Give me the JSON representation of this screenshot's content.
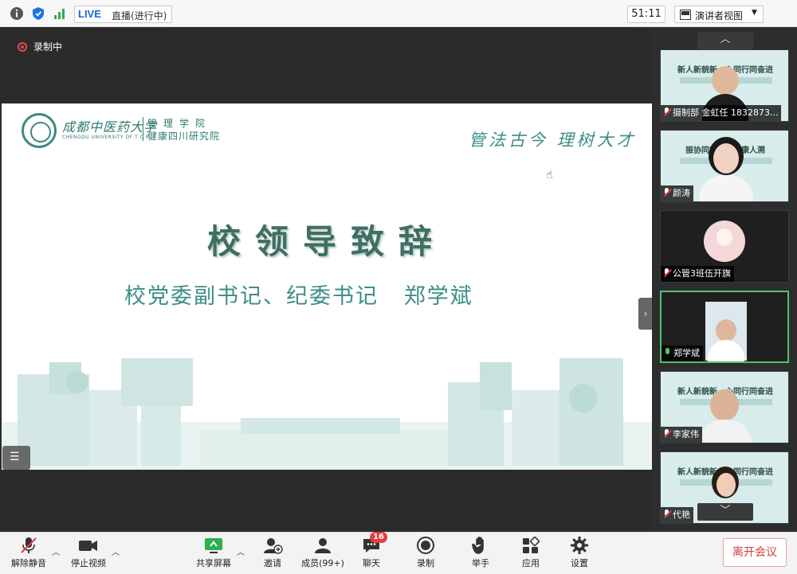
{
  "topbar": {
    "live_label": "LIVE",
    "live_status": "直播(进行中)",
    "timer": "51:11",
    "view_mode": "演讲者视图"
  },
  "main": {
    "recording_label": "录制中"
  },
  "slide": {
    "university_cn": "成都中医药大学",
    "university_en": "CHENGDU UNIVERSITY OF T C M",
    "school_line1": "管理学院",
    "school_line2": "健康四川研究院",
    "motto": "管法古今 理树大才",
    "title": "校领导致辞",
    "subtitle": "校党委副书记、纪委书记   郑学斌"
  },
  "gallery": {
    "tiles": [
      {
        "name": "摄制部 金虹任 1832873...",
        "muted": true,
        "banner": "新人新貌新…心同行同奋进"
      },
      {
        "name": "颜涛",
        "muted": true,
        "banner": "振协同行同…健康人溯"
      },
      {
        "name": "公管3班伍开旗",
        "muted": true,
        "banner": ""
      },
      {
        "name": "郑学斌",
        "muted": false,
        "banner": ""
      },
      {
        "name": "李家伟",
        "muted": true,
        "banner": "新人新貌新…心同行同奋进"
      },
      {
        "name": "代艳",
        "muted": true,
        "banner": "新人新貌新…心同行同奋进"
      }
    ]
  },
  "toolbar": {
    "unmute": "解除静音",
    "stop_video": "停止视频",
    "share_screen": "共享屏幕",
    "invite": "邀请",
    "members": "成员(99+)",
    "chat": "聊天",
    "chat_badge": "16",
    "record": "录制",
    "raise_hand": "举手",
    "apps": "应用",
    "settings": "设置",
    "leave": "离开会议"
  },
  "colors": {
    "accent_green": "#4fc26c",
    "brand_teal": "#3b8d86",
    "leave_red": "#d63b3b"
  }
}
